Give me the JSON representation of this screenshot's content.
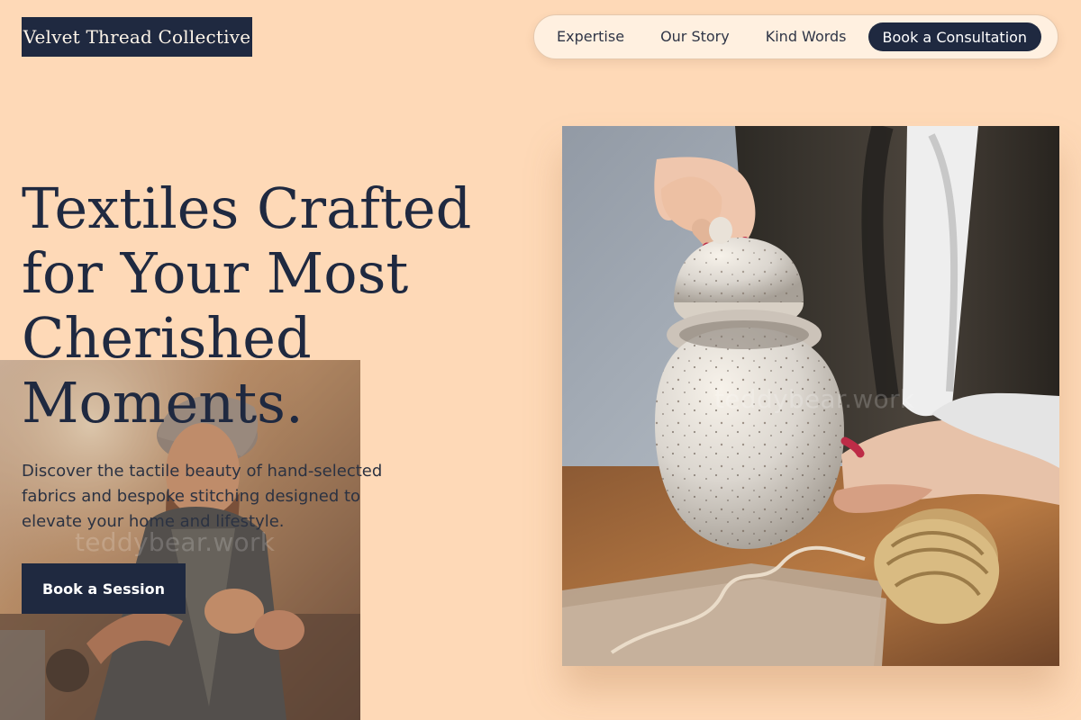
{
  "brand": {
    "name": "Velvet Thread Collective"
  },
  "nav": {
    "items": [
      {
        "label": "Expertise"
      },
      {
        "label": "Our Story"
      },
      {
        "label": "Kind Words"
      }
    ],
    "cta_label": "Book a Consultation"
  },
  "hero": {
    "title": "Textiles Crafted for Your Most Cherished Moments.",
    "description": "Discover the tactile beauty of hand-selected fabrics and bespoke stitching designed to elevate your home and lifestyle.",
    "button_label": "Book a Session"
  },
  "images": {
    "left_watermark": "teddybear.work",
    "right_watermark": "teddybear.work"
  },
  "colors": {
    "background": "#fed9b7",
    "navy": "#1f2940",
    "nav_background": "#fff0e0"
  }
}
